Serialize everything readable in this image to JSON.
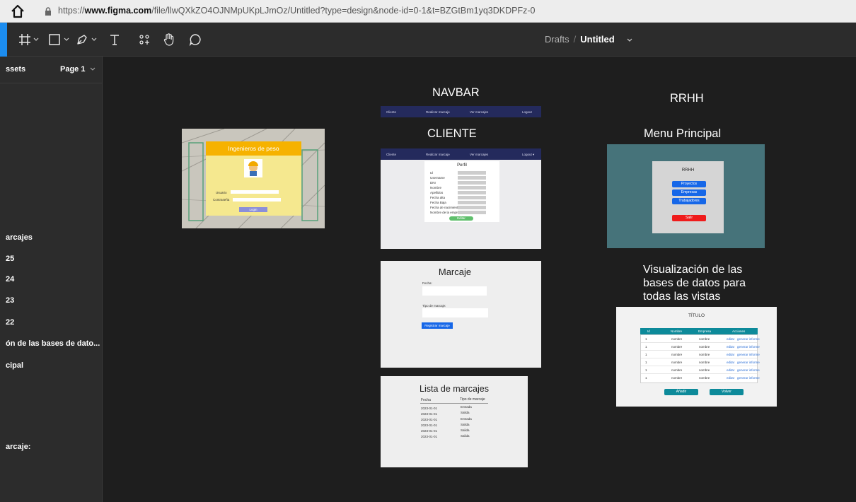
{
  "browser": {
    "url_prefix": "https://",
    "url_domain": "www.figma.com",
    "url_path": "/file/llwQXkZO4OJNMpUKpLJmOz/Untitled?type=design&node-id=0-1&t=BZGtBm1yq3DKDPFz-0"
  },
  "toolbar": {
    "tools": [
      "frame-tool",
      "shape-tool",
      "pen-tool",
      "text-tool",
      "resources-tool",
      "hand-tool",
      "comment-tool"
    ],
    "breadcrumb_parent": "Drafts",
    "breadcrumb_sep": "/",
    "breadcrumb_current": "Untitled"
  },
  "left_panel": {
    "assets_tab": "ssets",
    "page_selector": "Page 1",
    "layers": [
      "arcajes",
      "25",
      "24",
      "23",
      "22",
      "ón de las bases de dato...",
      "cipal",
      "arcaje:"
    ]
  },
  "frames": {
    "login": {
      "title": "Ingenieros de peso",
      "user_label": "Usuario",
      "pass_label": "Contraseña",
      "button": "Login"
    },
    "navbar": {
      "label": "NAVBAR",
      "items": [
        "Cliente",
        "Realizar marcaje",
        "Ver marcajes",
        "Logout"
      ]
    },
    "cliente": {
      "label": "CLIENTE",
      "nav_items": [
        "Cliente",
        "Realizar marcaje",
        "Ver marcajes",
        "Logout ▾"
      ],
      "card_title": "Perfil",
      "fields": [
        "Id",
        "Username",
        "DNI",
        "Nombre",
        "Apellidos",
        "Fecha alta",
        "Fecha Baja",
        "Fecha de nacimiento",
        "Nombre de la empresa"
      ],
      "button": "Editar"
    },
    "rrhh": {
      "label": "RRHH",
      "menu_label": "Menu Principal",
      "card_title": "RRHH",
      "buttons": [
        "Proyectos",
        "Empresas",
        "Trabajadores"
      ],
      "exit": "Salir"
    },
    "marcaje": {
      "title": "Marcaje",
      "fecha_label": "Fecha:",
      "tipo_label": "Tipo de marcaje:",
      "button": "Registrar marcaje"
    },
    "visualizacion": {
      "label_line1": "Visualización de las",
      "label_line2": "bases de datos para",
      "label_line3": "todas las vistas",
      "table_title": "TÍTULO",
      "columns": [
        "Id",
        "Nombre",
        "Empresa",
        "Acciones"
      ],
      "rows": [
        [
          "1",
          "nombre",
          "nombre",
          "editar",
          "generar informe"
        ],
        [
          "1",
          "nombre",
          "nombre",
          "editar",
          "generar informe"
        ],
        [
          "1",
          "nombre",
          "nombre",
          "editar",
          "generar informe"
        ],
        [
          "1",
          "nombre",
          "nombre",
          "editar",
          "generar informe"
        ],
        [
          "1",
          "nombre",
          "nombre",
          "editar",
          "generar informe"
        ],
        [
          "1",
          "nombre",
          "nombre",
          "editar",
          "generar informe"
        ]
      ],
      "btn_add": "Añadir",
      "btn_back": "Volver"
    },
    "lista": {
      "title": "Lista de marcajes",
      "col_fecha": "Fecha",
      "col_tipo": "Tipo de marcaje",
      "rows": [
        [
          "2023-01-01",
          "Entrada"
        ],
        [
          "2023-01-01",
          "Salida"
        ],
        [
          "2023-01-01",
          "Entrada"
        ],
        [
          "2023-01-01",
          "Salida"
        ],
        [
          "2023-01-01",
          "Salida"
        ],
        [
          "2023-01-01",
          "Salida"
        ]
      ]
    }
  },
  "colors": {
    "canvas": "#1e1e1e",
    "panel": "#2c2c2c",
    "accent": "#1c8df0",
    "navbar": "#242a5c",
    "rrhh_bg": "#46737a",
    "teal": "#0d8a9a"
  }
}
